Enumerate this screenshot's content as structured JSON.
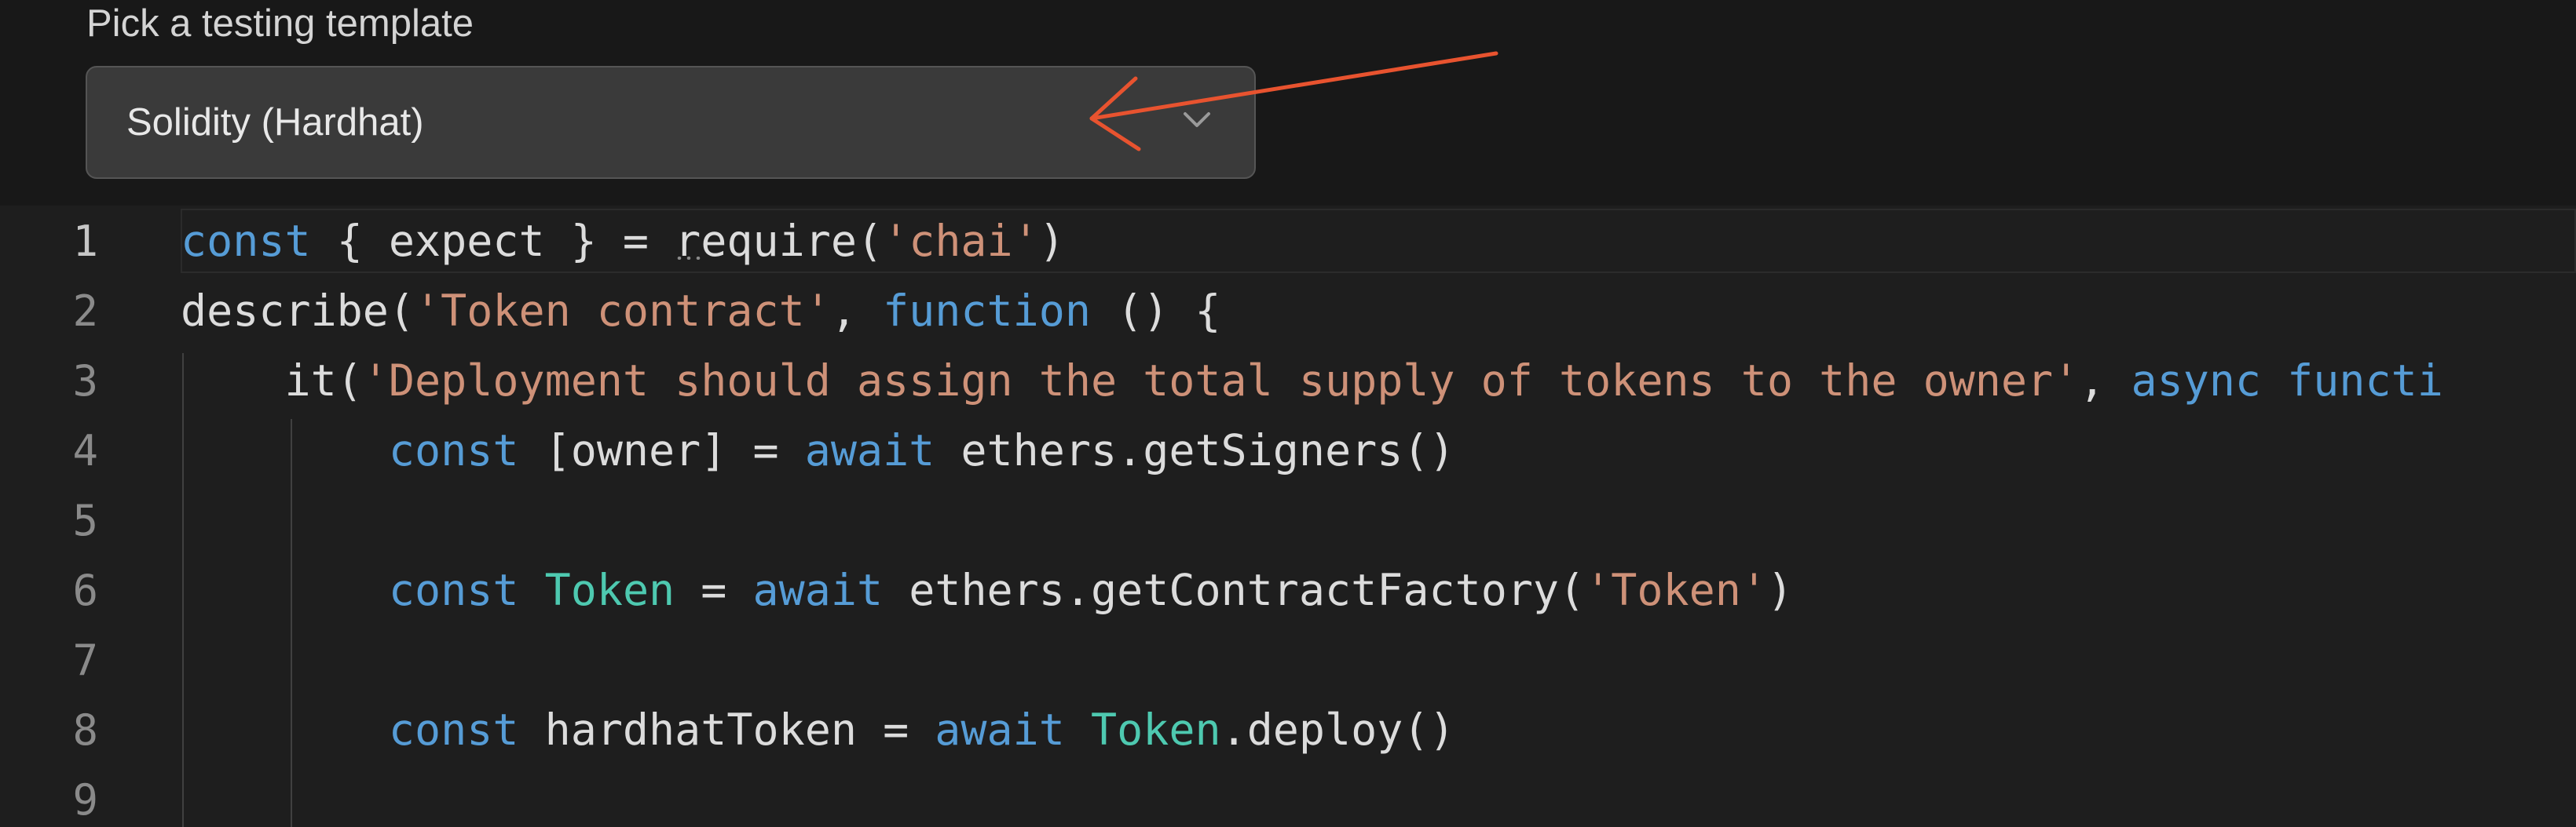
{
  "template_picker": {
    "label": "Pick a testing template",
    "selected": "Solidity (Hardhat)"
  },
  "icons": {
    "dropdown": "chevron-down-icon",
    "annotation": "arrow-annotation"
  },
  "colors": {
    "keyword": "#569cd6",
    "string": "#ce9178",
    "class": "#4ec9b0",
    "annotation_arrow": "#e8532f"
  },
  "editor": {
    "lines": [
      {
        "number": "1",
        "tokens": [
          {
            "type": "kw",
            "text": "const"
          },
          {
            "type": "txt",
            "text": " { expect } = "
          },
          {
            "type": "txt",
            "text": "r",
            "squiggle": true
          },
          {
            "type": "txt",
            "text": "equire("
          },
          {
            "type": "str",
            "text": "'chai'"
          },
          {
            "type": "txt",
            "text": ")"
          }
        ]
      },
      {
        "number": "2",
        "tokens": [
          {
            "type": "txt",
            "text": "describe("
          },
          {
            "type": "str",
            "text": "'Token contract'"
          },
          {
            "type": "txt",
            "text": ", "
          },
          {
            "type": "kw",
            "text": "function"
          },
          {
            "type": "txt",
            "text": " () {"
          }
        ]
      },
      {
        "number": "3",
        "tokens": [
          {
            "type": "txt",
            "text": "    it("
          },
          {
            "type": "str",
            "text": "'Deployment should assign the total supply of tokens to the owner'"
          },
          {
            "type": "txt",
            "text": ", "
          },
          {
            "type": "kw",
            "text": "async functi"
          }
        ]
      },
      {
        "number": "4",
        "tokens": [
          {
            "type": "txt",
            "text": "        "
          },
          {
            "type": "kw",
            "text": "const"
          },
          {
            "type": "txt",
            "text": " [owner] = "
          },
          {
            "type": "kw",
            "text": "await"
          },
          {
            "type": "txt",
            "text": " ethers.getSigners()"
          }
        ]
      },
      {
        "number": "5",
        "tokens": []
      },
      {
        "number": "6",
        "tokens": [
          {
            "type": "txt",
            "text": "        "
          },
          {
            "type": "kw",
            "text": "const"
          },
          {
            "type": "txt",
            "text": " "
          },
          {
            "type": "cls",
            "text": "Token"
          },
          {
            "type": "txt",
            "text": " = "
          },
          {
            "type": "kw",
            "text": "await"
          },
          {
            "type": "txt",
            "text": " ethers.getContractFactory("
          },
          {
            "type": "str",
            "text": "'Token'"
          },
          {
            "type": "txt",
            "text": ")"
          }
        ]
      },
      {
        "number": "7",
        "tokens": []
      },
      {
        "number": "8",
        "tokens": [
          {
            "type": "txt",
            "text": "        "
          },
          {
            "type": "kw",
            "text": "const"
          },
          {
            "type": "txt",
            "text": " hardhatToken = "
          },
          {
            "type": "kw",
            "text": "await"
          },
          {
            "type": "txt",
            "text": " "
          },
          {
            "type": "cls",
            "text": "Token"
          },
          {
            "type": "txt",
            "text": ".deploy()"
          }
        ]
      },
      {
        "number": "9",
        "tokens": []
      }
    ]
  }
}
